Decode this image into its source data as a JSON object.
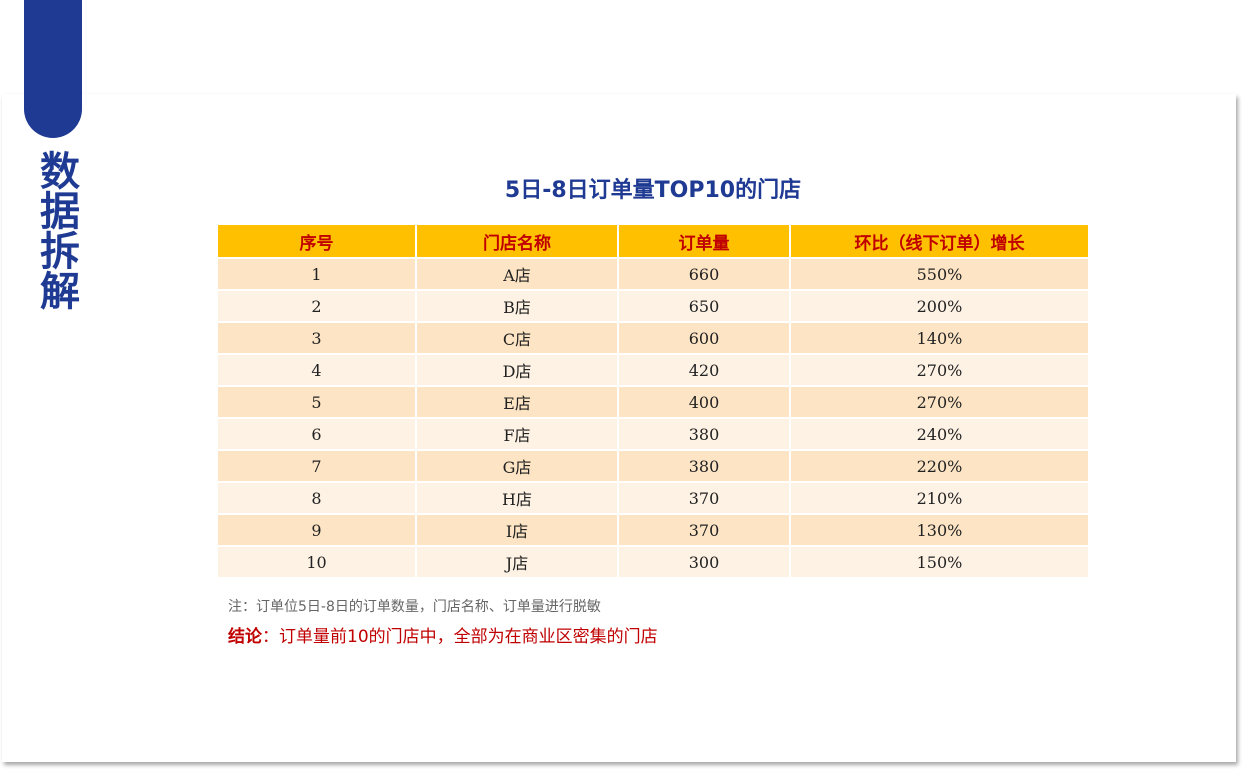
{
  "side_title": "数据拆解",
  "table": {
    "title": "5日-8日订单量TOP10的门店",
    "headers": [
      "序号",
      "门店名称",
      "订单量",
      "环比（线下订单）增长"
    ],
    "rows": [
      [
        "1",
        "A店",
        "660",
        "550%"
      ],
      [
        "2",
        "B店",
        "650",
        "200%"
      ],
      [
        "3",
        "C店",
        "600",
        "140%"
      ],
      [
        "4",
        "D店",
        "420",
        "270%"
      ],
      [
        "5",
        "E店",
        "400",
        "270%"
      ],
      [
        "6",
        "F店",
        "380",
        "240%"
      ],
      [
        "7",
        "G店",
        "380",
        "220%"
      ],
      [
        "8",
        "H店",
        "370",
        "210%"
      ],
      [
        "9",
        "I店",
        "370",
        "130%"
      ],
      [
        "10",
        "J店",
        "300",
        "150%"
      ]
    ]
  },
  "note": "注：订单位5日-8日的订单数量，门店名称、订单量进行脱敏",
  "conclusion": {
    "label": "结论",
    "text": "：订单量前10的门店中，全部为在商业区密集的门店"
  },
  "colors": {
    "accent_blue": "#1f3a93",
    "header_bg": "#ffc000",
    "header_text": "#c00000",
    "row_odd": "#fce4c4",
    "row_even": "#fdf2e4"
  }
}
